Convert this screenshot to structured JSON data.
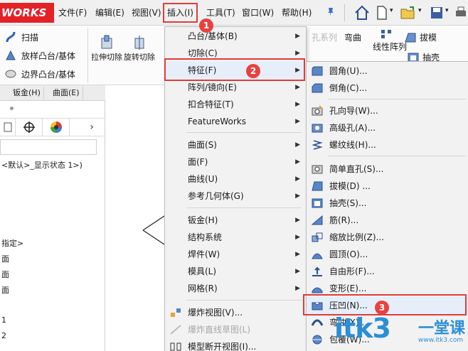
{
  "app": {
    "logo_text": "WORKS"
  },
  "menubar": {
    "items": [
      {
        "label": "文件(F)"
      },
      {
        "label": "编辑(E)"
      },
      {
        "label": "视图(V)"
      },
      {
        "label": "插入(I)"
      },
      {
        "label": "工具(T)"
      },
      {
        "label": "窗口(W)"
      },
      {
        "label": "帮助(H)"
      }
    ]
  },
  "featurebar": {
    "sweep": "扫描",
    "loft": "放样凸台/基体",
    "boundary": "边界凸台/基体",
    "extrude_cut": "拉伸切除",
    "revolve_cut": "旋转切除",
    "draft": "拔模",
    "hole_series": "孔系列",
    "bend": "弯曲",
    "linear_pattern": "线性阵列",
    "shell": "抽壳"
  },
  "left_panel": {
    "tabs": [
      {
        "label": "钣金(H)"
      },
      {
        "label": "曲面(E)"
      }
    ],
    "display_state": "<默认>_显示状态 1>)",
    "tree_lines": [
      "指定>",
      "面",
      "面",
      "面",
      "1",
      "2"
    ]
  },
  "insert_menu": {
    "items": [
      {
        "label": "凸台/基体(B)",
        "submenu": true
      },
      {
        "label": "切除(C)",
        "submenu": true
      },
      {
        "label": "特征(F)",
        "submenu": true,
        "highlighted": true
      },
      {
        "label": "阵列/镜向(E)",
        "submenu": true
      },
      {
        "label": "扣合特征(T)",
        "submenu": true
      },
      {
        "label": "FeatureWorks",
        "submenu": true
      },
      {
        "label": "曲面(S)",
        "submenu": true
      },
      {
        "label": "面(F)",
        "submenu": true
      },
      {
        "label": "曲线(U)",
        "submenu": true
      },
      {
        "label": "参考几何体(G)",
        "submenu": true
      },
      {
        "label": "钣金(H)",
        "submenu": true
      },
      {
        "label": "结构系统",
        "submenu": true
      },
      {
        "label": "焊件(W)",
        "submenu": true
      },
      {
        "label": "模具(L)",
        "submenu": true
      },
      {
        "label": "网格(R)",
        "submenu": true
      },
      {
        "label": "爆炸视图(V)...",
        "submenu": false
      },
      {
        "label": "爆炸直线草图(L)",
        "submenu": false,
        "disabled": true
      },
      {
        "label": "模型断开视图(I)...",
        "submenu": false
      }
    ]
  },
  "feature_menu": {
    "items": [
      {
        "label": "圆角(U)...",
        "icon": "fillet-icon"
      },
      {
        "label": "倒角(C)...",
        "icon": "chamfer-icon"
      },
      {
        "label": "孔向导(W)...",
        "icon": "hole-wizard-icon"
      },
      {
        "label": "高级孔(A)...",
        "icon": "advanced-hole-icon"
      },
      {
        "label": "螺纹线(H)...",
        "icon": "thread-icon"
      },
      {
        "label": "简单直孔(S)...",
        "icon": "simple-hole-icon"
      },
      {
        "label": "拔模(D) ...",
        "icon": "draft-icon"
      },
      {
        "label": "抽壳(S)...",
        "icon": "shell-icon"
      },
      {
        "label": "筋(R)...",
        "icon": "rib-icon"
      },
      {
        "label": "缩放比例(Z)...",
        "icon": "scale-icon"
      },
      {
        "label": "圆顶(O)...",
        "icon": "dome-icon"
      },
      {
        "label": "自由形(F)...",
        "icon": "freeform-icon"
      },
      {
        "label": "变形(E)...",
        "icon": "deform-icon"
      },
      {
        "label": "压凹(N)...",
        "icon": "indent-icon",
        "highlighted": true
      },
      {
        "label": "弯曲(X)...",
        "icon": "flex-icon"
      },
      {
        "label": "包覆(W)...",
        "icon": "wrap-icon"
      }
    ]
  },
  "steps": [
    "1",
    "2",
    "3"
  ],
  "watermark": {
    "text": "itk3",
    "sub": "一堂课",
    "url": "www.itk3.com"
  },
  "colors": {
    "highlight": "#e03b3b",
    "step_badge": "#e8413f",
    "watermark": "#2b8fd6"
  }
}
